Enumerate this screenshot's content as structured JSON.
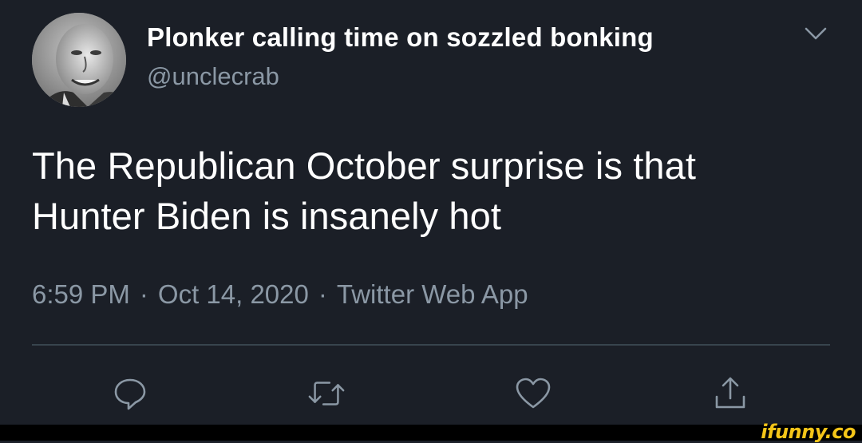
{
  "tweet": {
    "display_name": "Plonker calling time on sozzled bonking",
    "handle": "@unclecrab",
    "text_line1": "The Republican October surprise is that",
    "text_line2": "Hunter Biden is insanely hot",
    "time": "6:59 PM",
    "date": "Oct 14, 2020",
    "source": "Twitter Web App",
    "separator": "·"
  },
  "actions": {
    "reply_icon": "reply-bubble-icon",
    "retweet_icon": "retweet-icon",
    "like_icon": "heart-icon",
    "share_icon": "share-upload-icon"
  },
  "colors": {
    "background": "#1b1f27",
    "secondary_text": "#8b98a5",
    "divider": "#38444d",
    "watermark": "#f5c518"
  },
  "watermark": {
    "text": "ifunny.co"
  }
}
